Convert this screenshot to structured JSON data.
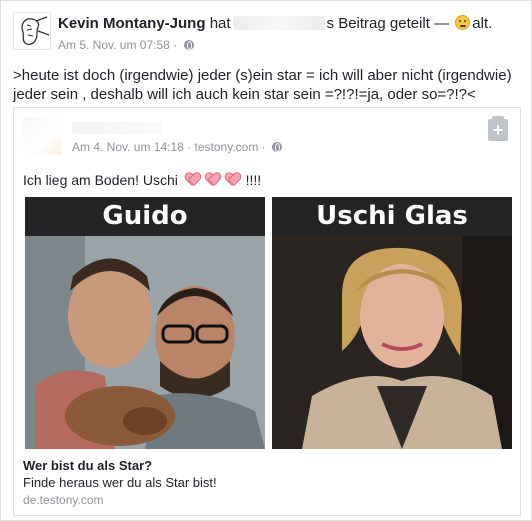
{
  "post": {
    "author": "Kevin Montany-Jung",
    "action_prefix": "hat",
    "action_suffix": "s Beitrag geteilt —",
    "feeling": "alt.",
    "timestamp": "Am 5. Nov. um 07:58",
    "separator": "·",
    "text": ">heute ist doch  (irgendwie) jeder (s)ein star =  ich will aber nicht (irgendwie) jeder sein , deshalb will ich auch kein star sein =?!?!=ja, oder so=?!?<"
  },
  "shared": {
    "timestamp": "Am 4. Nov. um 14:18",
    "source": "testony.com",
    "separator": "·",
    "text": "Ich lieg am Boden! Uschi",
    "text_suffix": "!!!!",
    "panels": [
      {
        "title": "Guido"
      },
      {
        "title": "Uschi Glas"
      }
    ],
    "link": {
      "title": "Wer bist du als Star?",
      "description": "Finde heraus wer du als Star bist!",
      "domain": "de.testony.com"
    }
  },
  "icons": {
    "audience": "globe-icon",
    "save": "save-icon",
    "hearts": "heart-icon",
    "feeling": "emoji-icon"
  },
  "colors": {
    "meta_gray": "#90949c",
    "border": "#dddfe2",
    "heart": "#f6a6b0"
  }
}
